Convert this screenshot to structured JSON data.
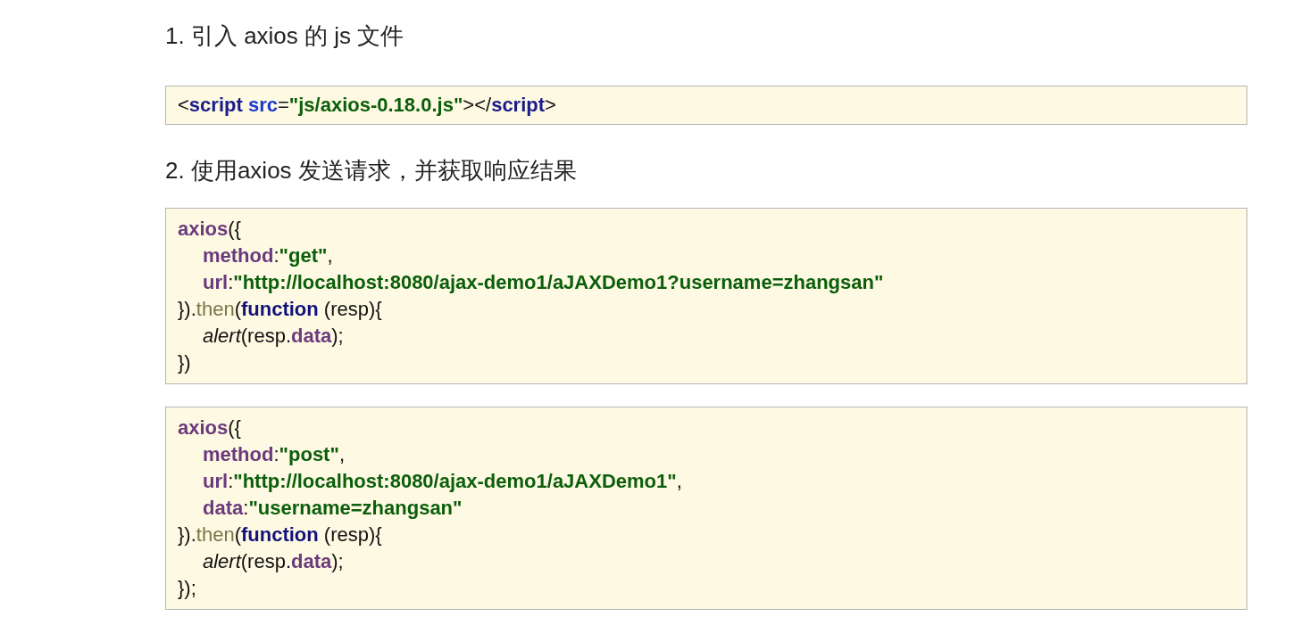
{
  "sections": [
    {
      "heading": "1. 引入 axios 的 js 文件",
      "code_blocks": [
        {
          "lines": [
            {
              "tokens": [
                {
                  "kind": "plain",
                  "text": "<"
                },
                {
                  "kind": "tag",
                  "text": "script"
                },
                {
                  "kind": "attr",
                  "text": " src"
                },
                {
                  "kind": "plain",
                  "text": "="
                },
                {
                  "kind": "string",
                  "text": "\"js/axios-0.18.0.js\""
                },
                {
                  "kind": "plain",
                  "text": "></"
                },
                {
                  "kind": "tag",
                  "text": "script"
                },
                {
                  "kind": "plain",
                  "text": ">"
                }
              ]
            }
          ]
        }
      ]
    },
    {
      "heading": "2. 使用axios 发送请求，并获取响应结果",
      "code_blocks": [
        {
          "lines": [
            {
              "tokens": [
                {
                  "kind": "property",
                  "text": "axios"
                },
                {
                  "kind": "plain",
                  "text": "({"
                }
              ],
              "children": [
                {
                  "tokens": [
                    {
                      "kind": "property",
                      "text": "method"
                    },
                    {
                      "kind": "plain",
                      "text": ":"
                    },
                    {
                      "kind": "string",
                      "text": "\"get\""
                    },
                    {
                      "kind": "plain",
                      "text": ","
                    }
                  ]
                },
                {
                  "tokens": [
                    {
                      "kind": "property",
                      "text": "url"
                    },
                    {
                      "kind": "plain",
                      "text": ":"
                    },
                    {
                      "kind": "string",
                      "text": "\"http://localhost:8080/ajax-demo1/aJAXDemo1?username=zhangsan\""
                    }
                  ]
                }
              ]
            },
            {
              "tokens": [
                {
                  "kind": "plain",
                  "text": "})."
                },
                {
                  "kind": "method",
                  "text": "then"
                },
                {
                  "kind": "plain",
                  "text": "("
                },
                {
                  "kind": "keyword",
                  "text": "function"
                },
                {
                  "kind": "plain",
                  "text": " (resp){"
                }
              ],
              "children": [
                {
                  "tokens": [
                    {
                      "kind": "italic",
                      "text": "alert"
                    },
                    {
                      "kind": "plain",
                      "text": "(resp."
                    },
                    {
                      "kind": "property",
                      "text": "data"
                    },
                    {
                      "kind": "plain",
                      "text": ");"
                    }
                  ]
                }
              ]
            },
            {
              "tokens": [
                {
                  "kind": "plain",
                  "text": "})"
                }
              ]
            }
          ]
        },
        {
          "lines": [
            {
              "tokens": [
                {
                  "kind": "property",
                  "text": "axios"
                },
                {
                  "kind": "plain",
                  "text": "({"
                }
              ],
              "children": [
                {
                  "tokens": [
                    {
                      "kind": "property",
                      "text": "method"
                    },
                    {
                      "kind": "plain",
                      "text": ":"
                    },
                    {
                      "kind": "string",
                      "text": "\"post\""
                    },
                    {
                      "kind": "plain",
                      "text": ","
                    }
                  ]
                },
                {
                  "tokens": [
                    {
                      "kind": "property",
                      "text": "url"
                    },
                    {
                      "kind": "plain",
                      "text": ":"
                    },
                    {
                      "kind": "string",
                      "text": "\"http://localhost:8080/ajax-demo1/aJAXDemo1\""
                    },
                    {
                      "kind": "plain",
                      "text": ","
                    }
                  ]
                },
                {
                  "tokens": [
                    {
                      "kind": "property",
                      "text": "data"
                    },
                    {
                      "kind": "plain",
                      "text": ":"
                    },
                    {
                      "kind": "string",
                      "text": "\"username=zhangsan\""
                    }
                  ]
                }
              ]
            },
            {
              "tokens": [
                {
                  "kind": "plain",
                  "text": "})."
                },
                {
                  "kind": "method",
                  "text": "then"
                },
                {
                  "kind": "plain",
                  "text": "("
                },
                {
                  "kind": "keyword",
                  "text": "function"
                },
                {
                  "kind": "plain",
                  "text": " (resp){"
                }
              ],
              "children": [
                {
                  "tokens": [
                    {
                      "kind": "italic",
                      "text": "alert"
                    },
                    {
                      "kind": "plain",
                      "text": "(resp."
                    },
                    {
                      "kind": "property",
                      "text": "data"
                    },
                    {
                      "kind": "plain",
                      "text": ");"
                    }
                  ]
                }
              ]
            },
            {
              "tokens": [
                {
                  "kind": "plain",
                  "text": "});"
                }
              ]
            }
          ]
        }
      ]
    }
  ]
}
